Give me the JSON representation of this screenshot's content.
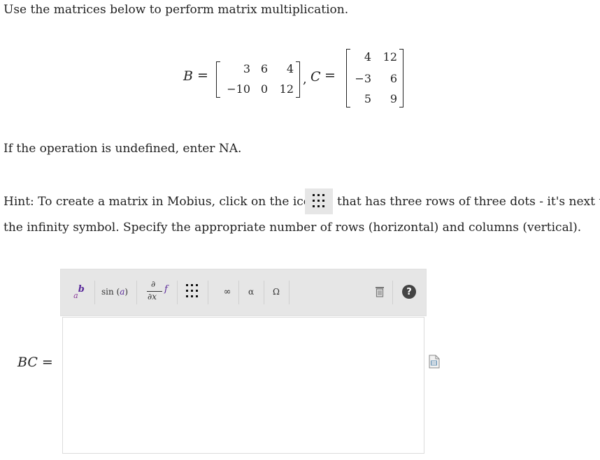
{
  "question": {
    "intro": "Use the matrices below to perform matrix multiplication.",
    "undefined_note": "If the operation is undefined, enter NA.",
    "hint_line1_a": "Hint: To create a matrix in Mobius, click on the icon",
    "hint_line1_b": "that has three rows of three dots - it's next to",
    "hint_line2": "the infinity symbol. Specify the appropriate number of rows (horizontal) and columns (vertical)."
  },
  "matrices": {
    "B_label": "B",
    "equals": "=",
    "comma": ",",
    "C_label": "C",
    "B": [
      [
        "3",
        "6",
        "4"
      ],
      [
        "−10",
        "0",
        "12"
      ]
    ],
    "C": [
      [
        "4",
        "12"
      ],
      [
        "−3",
        "6"
      ],
      [
        "5",
        "9"
      ]
    ]
  },
  "answer": {
    "label": "BC",
    "equals": "=",
    "value": ""
  },
  "toolbar": {
    "superscript_label_a": "a",
    "superscript_label_b": "b",
    "sin_label": "sin",
    "sin_arg": "a",
    "partial_top": "∂",
    "partial_bottom": "∂x",
    "partial_f": "f",
    "infinity_label": "∞",
    "alpha_label": "α",
    "omega_label": "Ω",
    "help_label": "?"
  }
}
